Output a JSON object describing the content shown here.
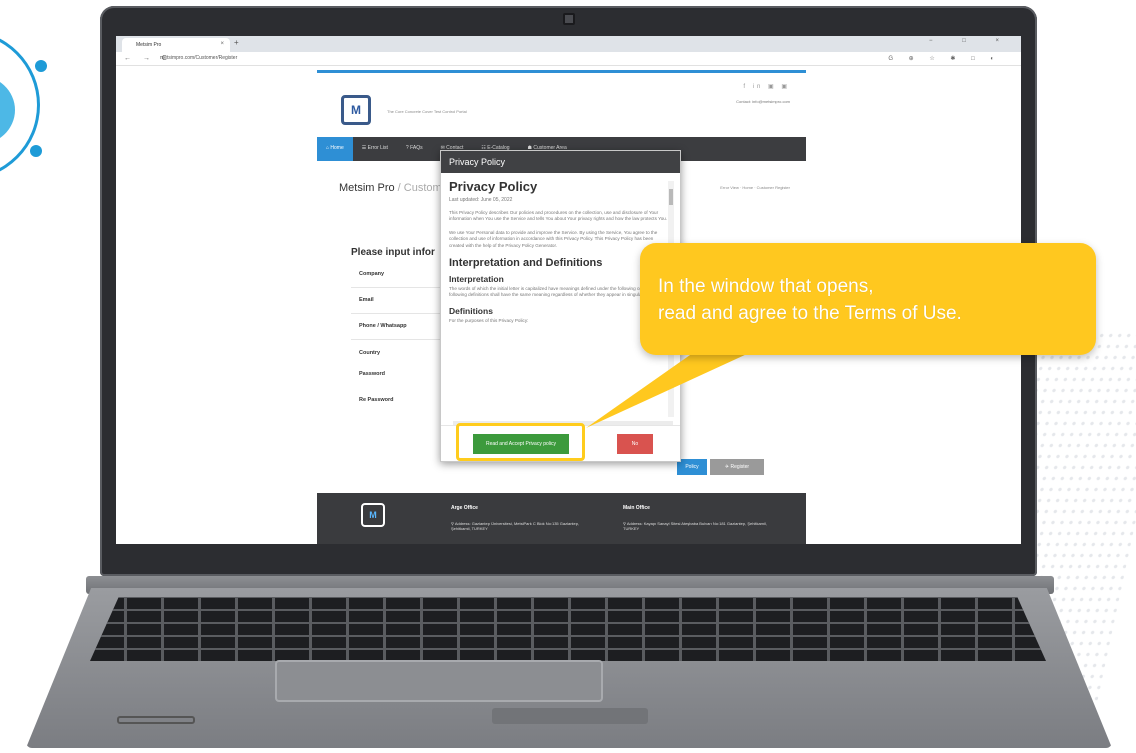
{
  "browser": {
    "tab_title": "Metsim Pro",
    "tab_close": "×",
    "new_tab": "+",
    "window_controls": "− □ ×",
    "nav_icons": "← → C",
    "url": "metsimpro.com/Customer/Register",
    "extension_icons": "G ⊕ ☆ ✱ □ ◐"
  },
  "site": {
    "logo": "M",
    "slogan": "The Core Concrete Cover Test Control Portal",
    "social": "f in ▣ ▣",
    "contact": "Contact: info@metsimpro.com",
    "nav": [
      "⌂ Home",
      "☰ Error List",
      "? FAQs",
      "✉ Contact",
      "☷ E-Catalog",
      "☗ Customer Area"
    ],
    "breadcrumb_main": "Metsim Pro",
    "breadcrumb_sep": " / ",
    "breadcrumb_sub": "Customer",
    "breadcrumb_right": "Error View · Home · Customer Register",
    "form_title": "Please input infor",
    "form_labels": [
      "Company",
      "Email",
      "Phone / Whatsapp",
      "Country",
      "Password",
      "Re Password"
    ],
    "policy_button": "Policy",
    "register_button": "✈ Register",
    "footer_logo": "M",
    "footer_arge_title": "Arge Office",
    "footer_arge_address": "⚲ Address: Gaziantep Üniversitesi, MetsiPark C Blok No:135 Gaziantep, Şehitkamil, TURKEY",
    "footer_main_title": "Main Office",
    "footer_main_address": "⚲ Address: Kayapı Sanayi Sitesi Ateşbaba Bulvarı No:181 Gaziantep, Şehitkamil, TURKEY"
  },
  "modal": {
    "header": "Privacy Policy",
    "title": "Privacy Policy",
    "updated": "Last updated: June 05, 2022",
    "para1": "This Privacy Policy describes Our policies and procedures on the collection, use and disclosure of Your information when You use the Service and tells You about Your privacy rights and how the law protects You.",
    "para2": "We use Your Personal data to provide and improve the Service. By using the Service, You agree to the collection and use of information in accordance with this Privacy Policy. This Privacy Policy has been created with the help of the Privacy Policy Generator.",
    "section": "Interpretation and Definitions",
    "sub1": "Interpretation",
    "para3": "The words of which the initial letter is capitalized have meanings defined under the following conditions. The following definitions shall have the same meaning regardless of whether they appear in singular or in plural.",
    "sub2": "Definitions",
    "para4": "For the purposes of this Privacy Policy:",
    "accept_button": "Read and Accept Privacy policy",
    "no_button": "No"
  },
  "callout": {
    "line1": "In the window that opens,",
    "line2": "read and agree to the Terms of Use."
  },
  "colors": {
    "accent": "#2e8fd5",
    "callout": "#ffc81f",
    "accept": "#3c9a3c",
    "no": "#d9534f"
  }
}
